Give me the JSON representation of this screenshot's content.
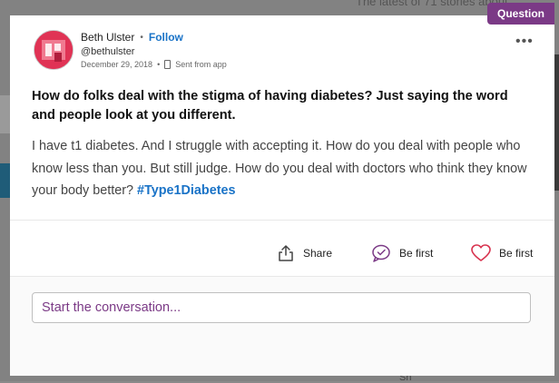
{
  "background": {
    "teaser_text": "The latest of 71 stories about",
    "bottom_text": "Sh"
  },
  "post": {
    "type_badge": "Question",
    "author": {
      "name": "Beth Ulster",
      "separator": "•",
      "follow_label": "Follow",
      "handle": "@bethulster",
      "date": "December 29, 2018",
      "meta_separator": "•",
      "source": "Sent from app"
    },
    "title": "How do folks deal with the stigma of having diabetes? Just saying the word and people look at you different.",
    "body": "I have t1 diabetes. And I struggle with accepting it. How do you deal with people who know less than you. But still judge. How do you deal with doctors who think they know your body better?",
    "hashtag": "#Type1Diabetes"
  },
  "actions": {
    "share_label": "Share",
    "comment_label": "Be first",
    "like_label": "Be first"
  },
  "comment_box": {
    "placeholder": "Start the conversation..."
  },
  "colors": {
    "accent_purple": "#7b3a86",
    "link_blue": "#1a73c7",
    "avatar_red": "#e03355"
  },
  "icons": [
    "more-options-icon",
    "phone-icon",
    "share-icon",
    "comment-icon",
    "heart-icon"
  ]
}
